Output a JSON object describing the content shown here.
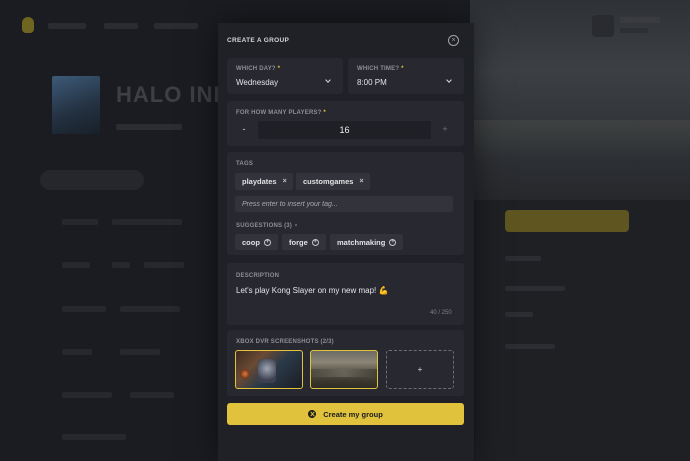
{
  "modal": {
    "title": "CREATE A GROUP",
    "close_icon": "×",
    "day": {
      "label": "WHICH DAY?",
      "required_mark": "*",
      "value": "Wednesday"
    },
    "time": {
      "label": "WHICH TIME?",
      "required_mark": "*",
      "value": "8:00 PM"
    },
    "players": {
      "label": "FOR HOW MANY PLAYERS?",
      "required_mark": "*",
      "value": "16",
      "decrement": "-",
      "increment": "+"
    },
    "tags": {
      "label": "TAGS",
      "items": [
        {
          "text": "playdates",
          "remove": "×"
        },
        {
          "text": "customgames",
          "remove": "×"
        }
      ],
      "input_placeholder": "Press enter to insert your tag...",
      "suggestions_label": "SUGGESTIONS (3)",
      "suggestions": [
        {
          "text": "coop",
          "add": "+"
        },
        {
          "text": "forge",
          "add": "+"
        },
        {
          "text": "matchmaking",
          "add": "+"
        }
      ]
    },
    "description": {
      "label": "DESCRIPTION",
      "text": "Let's play Kong Slayer on my new map! 💪",
      "counter": "40 / 250"
    },
    "screenshots": {
      "label": "XBOX DVR SCREENSHOTS (2/3)",
      "add_label": "+"
    },
    "create_button": {
      "label": "Create my group"
    }
  },
  "background": {
    "title": "HALO INFINITE"
  },
  "colors": {
    "accent": "#e0c23c",
    "modal_bg": "#202127",
    "card_bg": "#282930"
  },
  "icons": [
    "close-icon",
    "chevron-down-icon",
    "remove-tag-icon",
    "add-suggestion-icon",
    "add-screenshot-icon",
    "xbox-icon",
    "info-icon"
  ]
}
